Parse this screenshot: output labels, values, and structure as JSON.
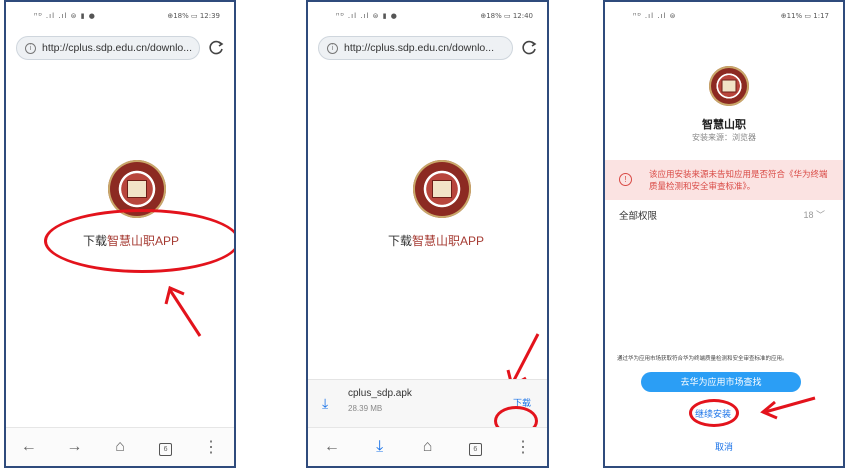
{
  "colors": {
    "accent_red": "#e3131c",
    "brand_red": "#a53a32",
    "link_blue": "#1a73e8",
    "store_button": "#2b9ef5"
  },
  "screen1": {
    "status_left": "ᴴᴰ .ıl .ıl ⊜ ▮ ●",
    "status_right": "⊕18% ▭ 12:39",
    "url": "http://cplus.sdp.edu.cn/downlo...",
    "download_prefix": "下载",
    "download_brand": "智慧山职APP",
    "nav": {
      "back": "←",
      "forward": "→",
      "home": "⌂",
      "tabs": "6",
      "menu": "⋮"
    }
  },
  "screen2": {
    "status_left": "ᴴᴰ .ıl .ıl ⊜ ▮ ●",
    "status_right": "⊕18% ▭ 12:40",
    "url": "http://cplus.sdp.edu.cn/downlo...",
    "download_prefix": "下载",
    "download_brand": "智慧山职APP",
    "file_name": "cplus_sdp.apk",
    "file_size": "28.39 MB",
    "download_button": "下载",
    "nav": {
      "back": "←",
      "download": "⤓",
      "home": "⌂",
      "tabs": "6",
      "menu": "⋮"
    }
  },
  "screen3": {
    "status_left": "ᴴᴰ .ıl .ıl ⊜",
    "status_right": "⊕11% ▭ 1:17",
    "app_name": "智慧山职",
    "source": "安装来源：浏览器",
    "warning": "该应用安装来源未告知应用是否符合《华为终端质量检测和安全审查标准》。",
    "permissions_label": "全部权限",
    "permissions_count": "18 ﹀",
    "fine_print": "通过华为应用市场获取符合华为终端质量检测和安全审查标准的应用。",
    "store_button": "去华为应用市场查找",
    "continue_install": "继续安装",
    "cancel": "取消"
  }
}
